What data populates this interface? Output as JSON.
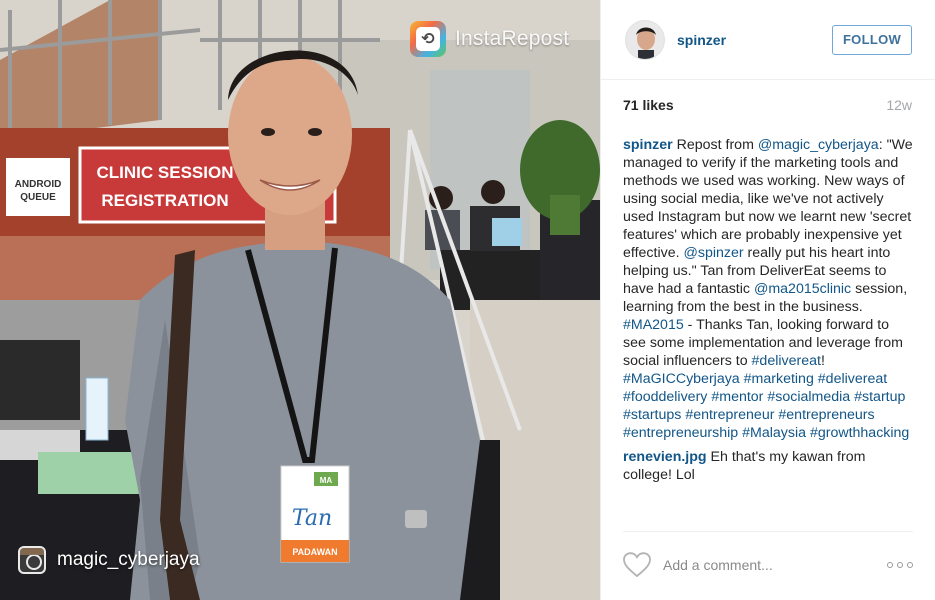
{
  "photo": {
    "repost_app_name": "InstaRepost",
    "credit_username": "magic_cyberjaya",
    "sign_clinic_line1": "CLINIC SESSION",
    "sign_clinic_line2": "REGISTRATION",
    "sign_android_line1": "ANDROID",
    "sign_android_line2": "QUEUE",
    "badge_logo": "MA",
    "badge_name": "Tan",
    "badge_role": "PADAWAN"
  },
  "header": {
    "username": "spinzer",
    "follow_label": "FOLLOW"
  },
  "stats": {
    "likes": "71 likes",
    "age": "12w"
  },
  "caption": {
    "user": "spinzer",
    "parts": {
      "p1": " Repost from ",
      "m1": "@magic_cyberjaya",
      "p2": ": \"We managed to verify if the marketing tools and methods we used was working. New ways of using social media, like we've not actively used Instagram but now we learnt new 'secret features' which are probably inexpensive yet effective. ",
      "m2": "@spinzer",
      "p3": " really put his heart into helping us.\" Tan from DeliverEat seems to have had a fantastic ",
      "m3": "@ma2015clinic",
      "p4": " session, learning from the best in the business. ",
      "h1": "#MA2015",
      "p5": " - Thanks Tan, looking forward to see some implementation and leverage from social influencers to ",
      "h2": "#delivereat",
      "p6": "! ",
      "h3": "#MaGICCyberjaya",
      "h4": "#marketing",
      "h5": "#delivereat",
      "h6": "#fooddelivery",
      "h7": "#mentor",
      "h8": "#socialmedia",
      "h9": "#startup",
      "h10": "#startups",
      "h11": "#entrepreneur",
      "h12": "#entrepreneurs",
      "h13": "#entrepreneurship",
      "h14": "#Malaysia",
      "h15": "#growthhacking"
    }
  },
  "reply": {
    "user": "renevien.jpg",
    "text": " Eh that's my kawan from college! Lol"
  },
  "footer": {
    "comment_placeholder": "Add a comment...",
    "like_icon": "heart-outline-icon",
    "more_icon": "more-options-icon"
  },
  "colors": {
    "username_blue": "#125688",
    "follow_text": "#3f729b",
    "follow_border": "#6fa8dc",
    "timestamp_gray": "#a5a7aa"
  }
}
